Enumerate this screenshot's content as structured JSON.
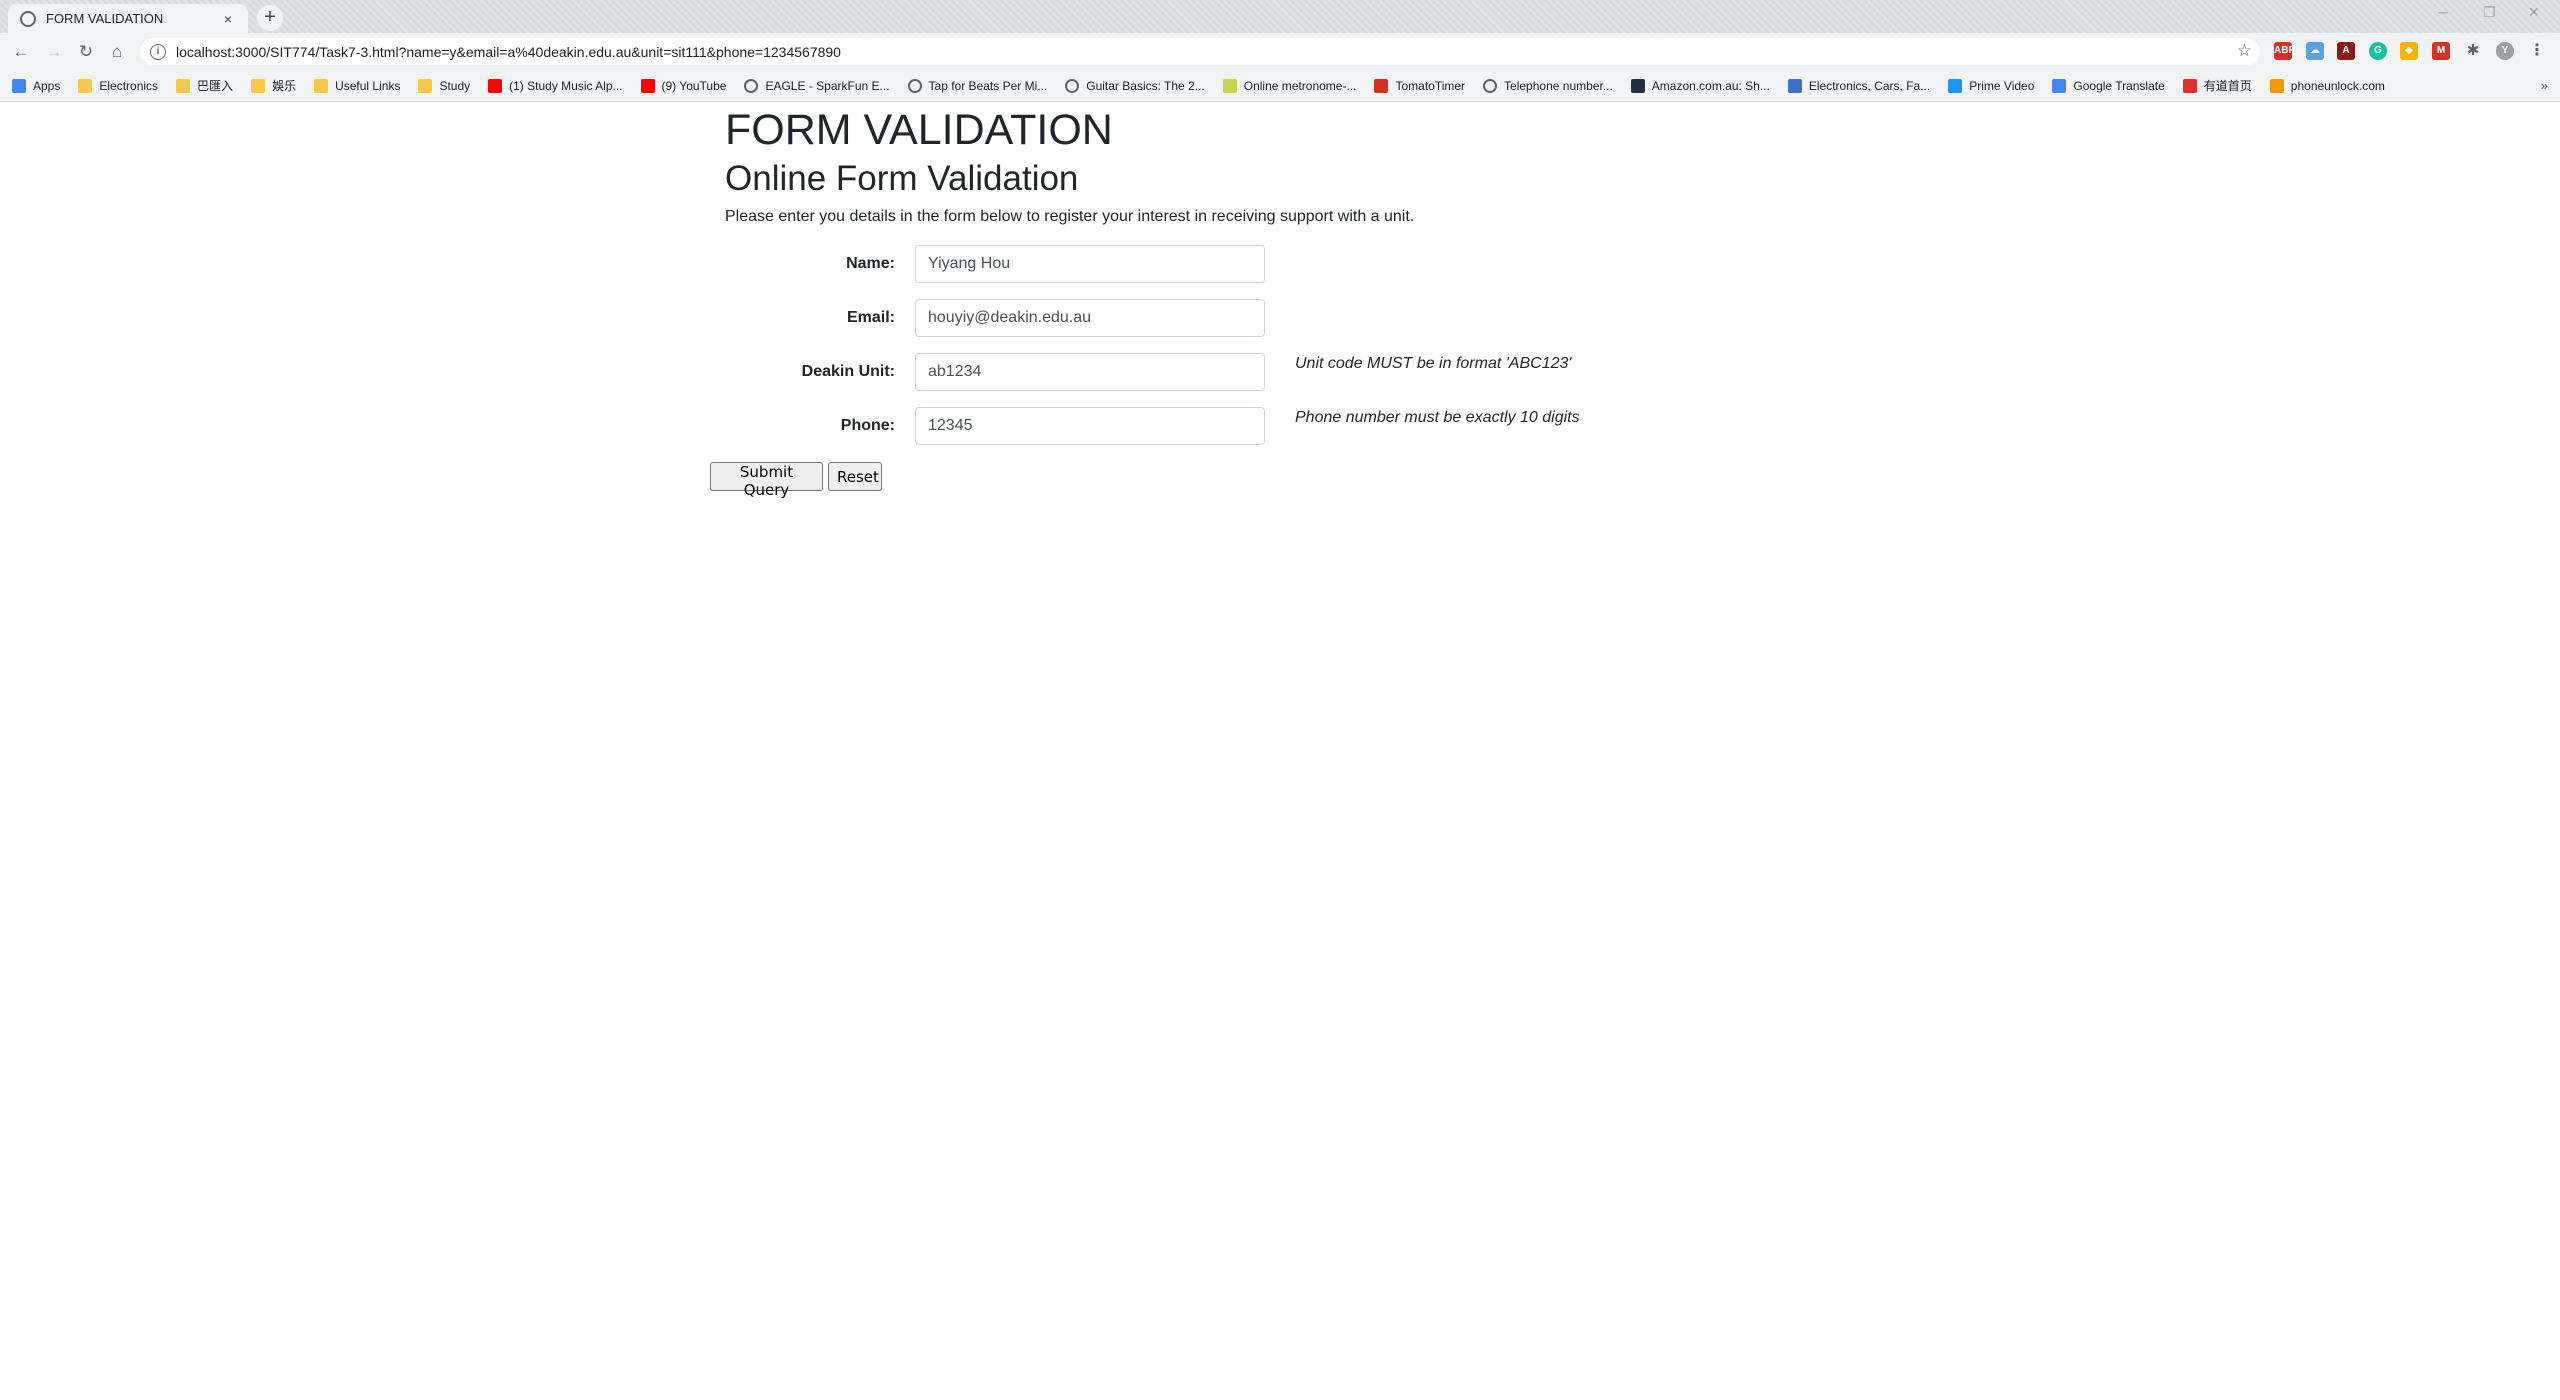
{
  "browser": {
    "tab_title": "FORM VALIDATION",
    "tab_close": "×",
    "new_tab": "+",
    "url": "localhost:3000/SIT774/Task7-3.html?name=y&email=a%40deakin.edu.au&unit=sit111&phone=1234567890",
    "extensions": [
      "ABP",
      "cloud",
      "pdf",
      "G",
      "shield",
      "M",
      "puzzle",
      "Y"
    ],
    "bookmarks": [
      {
        "label": "Apps",
        "icon": "apps-grid-icon",
        "color": "#4285f4"
      },
      {
        "label": "Electronics",
        "icon": "folder-icon",
        "color": "#f7c948"
      },
      {
        "label": "巴匯入",
        "icon": "folder-icon",
        "color": "#f7c948"
      },
      {
        "label": "娛乐",
        "icon": "folder-icon",
        "color": "#f7c948"
      },
      {
        "label": "Useful Links",
        "icon": "folder-icon",
        "color": "#f7c948"
      },
      {
        "label": "Study",
        "icon": "folder-icon",
        "color": "#f7c948"
      },
      {
        "label": "(1) Study Music Alp...",
        "icon": "youtube-icon",
        "color": "#ff0000"
      },
      {
        "label": "(9) YouTube",
        "icon": "youtube-icon",
        "color": "#ff0000"
      },
      {
        "label": "EAGLE - SparkFun E...",
        "icon": "globe-icon",
        "color": "#5f6368"
      },
      {
        "label": "Tap for Beats Per Mi...",
        "icon": "globe-icon",
        "color": "#5f6368"
      },
      {
        "label": "Guitar Basics: The 2...",
        "icon": "globe-icon",
        "color": "#5f6368"
      },
      {
        "label": "Online metronome-...",
        "icon": "metronome-icon",
        "color": "#c8d44a"
      },
      {
        "label": "TomatoTimer",
        "icon": "tomato-icon",
        "color": "#d93025"
      },
      {
        "label": "Telephone number...",
        "icon": "globe-icon",
        "color": "#5f6368"
      },
      {
        "label": "Amazon.com.au: Sh...",
        "icon": "amazon-icon",
        "color": "#232f3e"
      },
      {
        "label": "Electronics, Cars, Fa...",
        "icon": "ebay-icon",
        "color": "#3b73c8"
      },
      {
        "label": "Prime Video",
        "icon": "prime-video-icon",
        "color": "#1a98ff"
      },
      {
        "label": "Google Translate",
        "icon": "translate-icon",
        "color": "#4285f4"
      },
      {
        "label": "有道首页",
        "icon": "youdao-icon",
        "color": "#e0312e"
      },
      {
        "label": "phoneunlock.com",
        "icon": "phoneunlock-icon",
        "color": "#f29900"
      }
    ],
    "bookmarks_overflow": "»"
  },
  "page": {
    "heading": "FORM VALIDATION",
    "subheading": "Online Form Validation",
    "intro": "Please enter you details in the form below to register your interest in receiving support with a unit.",
    "form": {
      "name": {
        "label": "Name:",
        "value": "Yiyang Hou"
      },
      "email": {
        "label": "Email:",
        "value": "houyiy@deakin.edu.au"
      },
      "unit": {
        "label": "Deakin Unit:",
        "value": "ab1234",
        "hint": "Unit code MUST be in format 'ABC123'"
      },
      "phone": {
        "label": "Phone:",
        "value": "12345",
        "hint": "Phone number must be exactly 10 digits"
      },
      "submit_label": "Submit Query",
      "reset_label": "Reset"
    }
  }
}
